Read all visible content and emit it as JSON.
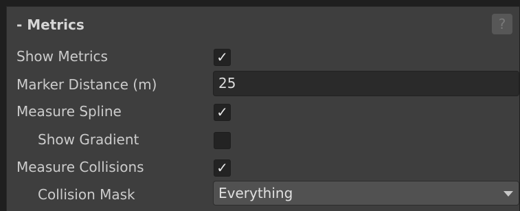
{
  "section": {
    "title": "- Metrics",
    "help_icon_glyph": "?"
  },
  "fields": {
    "show_metrics": {
      "label": "Show Metrics",
      "checked": true
    },
    "marker_distance": {
      "label": "Marker Distance (m)",
      "value": "25"
    },
    "measure_spline": {
      "label": "Measure Spline",
      "checked": true
    },
    "show_gradient": {
      "label": "Show Gradient",
      "checked": false
    },
    "measure_collisions": {
      "label": "Measure Collisions",
      "checked": true
    },
    "collision_mask": {
      "label": "Collision Mask",
      "value": "Everything"
    }
  },
  "icons": {
    "check": "✓"
  },
  "colors": {
    "panel_bg": "#3e3e3e",
    "label_text": "#cccccc",
    "field_bg": "#2a2a2a",
    "dropdown_bg": "#515151"
  }
}
